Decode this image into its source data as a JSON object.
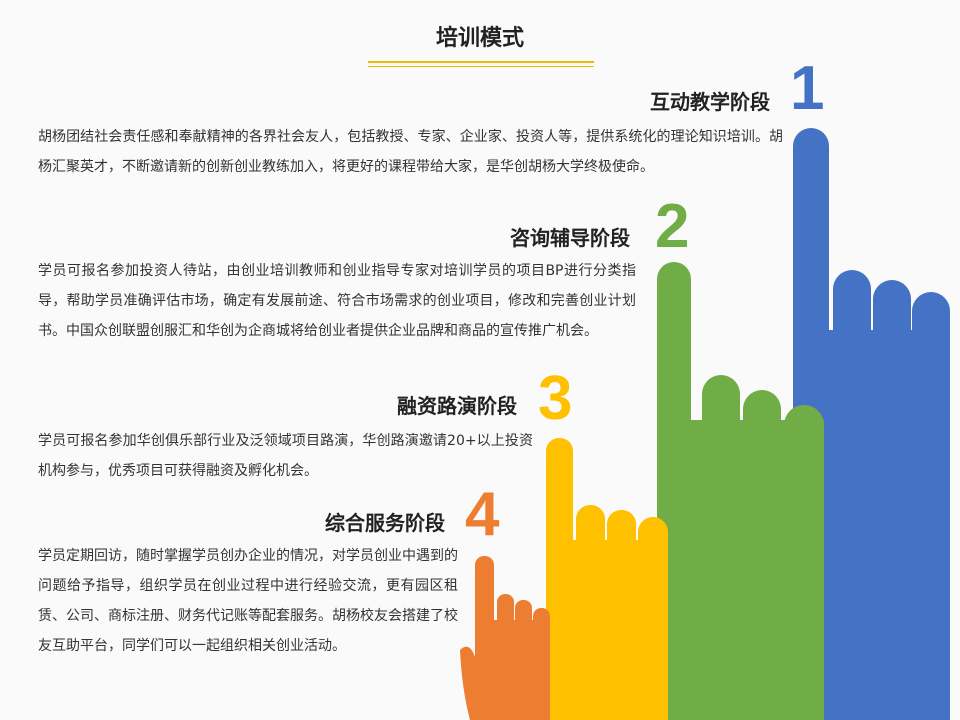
{
  "title": "培训模式",
  "colors": {
    "stage1": "#4472C4",
    "stage2": "#70AD47",
    "stage3": "#FFC000",
    "stage4": "#ED7D31",
    "underline": "#F5B800"
  },
  "stages": [
    {
      "number": "1",
      "heading": "互动教学阶段",
      "text": "胡杨团结社会责任感和奉献精神的各界社会友人，包括教授、专家、企业家、投资人等，提供系统化的理论知识培训。胡杨汇聚英才，不断邀请新的创新创业教练加入，将更好的课程带给大家，是华创胡杨大学终极使命。"
    },
    {
      "number": "2",
      "heading": "咨询辅导阶段",
      "text": "学员可报名参加投资人待站，由创业培训教师和创业指导专家对培训学员的项目BP进行分类指导，帮助学员准确评估市场，确定有发展前途、符合市场需求的创业项目，修改和完善创业计划书。中国众创联盟创服汇和华创为企商城将给创业者提供企业品牌和商品的宣传推广机会。"
    },
    {
      "number": "3",
      "heading": "融资路演阶段",
      "text": "学员可报名参加华创俱乐部行业及泛领域项目路演，华创路演邀请20+以上投资机构参与，优秀项目可获得融资及孵化机会。"
    },
    {
      "number": "4",
      "heading": "综合服务阶段",
      "text": "学员定期回访，随时掌握学员创办企业的情况，对学员创业中遇到的问题给予指导，组织学员在创业过程中进行经验交流，更有园区租赁、公司、商标注册、财务代记账等配套服务。胡杨校友会搭建了校友互助平台，同学们可以一起组织相关创业活动。"
    }
  ]
}
